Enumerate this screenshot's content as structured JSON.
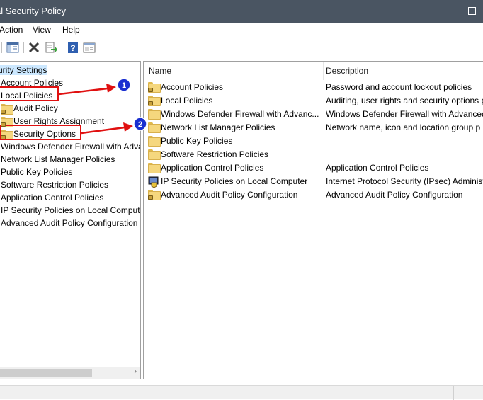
{
  "window": {
    "title": "al Security Policy"
  },
  "menu": {
    "action": "Action",
    "view": "View",
    "help": "Help"
  },
  "tree": {
    "root": "urity Settings",
    "items": [
      {
        "label": "Account Policies"
      },
      {
        "label": "Local Policies"
      },
      {
        "label": "Audit Policy"
      },
      {
        "label": "User Rights Assignment"
      },
      {
        "label": "Security Options"
      },
      {
        "label": "Windows Defender Firewall with Adva"
      },
      {
        "label": "Network List Manager Policies"
      },
      {
        "label": "Public Key Policies"
      },
      {
        "label": "Software Restriction Policies"
      },
      {
        "label": "Application Control Policies"
      },
      {
        "label": "IP Security Policies on Local Compute"
      },
      {
        "label": "Advanced Audit Policy Configuration"
      }
    ]
  },
  "list": {
    "headers": {
      "name": "Name",
      "description": "Description"
    },
    "rows": [
      {
        "name": "Account Policies",
        "description": "Password and account lockout policies"
      },
      {
        "name": "Local Policies",
        "description": "Auditing, user rights and security options p"
      },
      {
        "name": "Windows Defender Firewall with Advanc...",
        "description": "Windows Defender Firewall with Advanced"
      },
      {
        "name": "Network List Manager Policies",
        "description": "Network name, icon and location group p"
      },
      {
        "name": "Public Key Policies",
        "description": ""
      },
      {
        "name": "Software Restriction Policies",
        "description": ""
      },
      {
        "name": "Application Control Policies",
        "description": "Application Control Policies"
      },
      {
        "name": "IP Security Policies on Local Computer",
        "description": "Internet Protocol Security (IPsec) Administ"
      },
      {
        "name": "Advanced Audit Policy Configuration",
        "description": "Advanced Audit Policy Configuration"
      }
    ]
  },
  "annotations": {
    "marker1": "1",
    "marker2": "2"
  },
  "colors": {
    "titlebar": "#4a5562",
    "highlight_box": "#e01010",
    "arrow": "#e01010",
    "marker_fill": "#1a2fd0",
    "selection": "#cce8ff"
  }
}
